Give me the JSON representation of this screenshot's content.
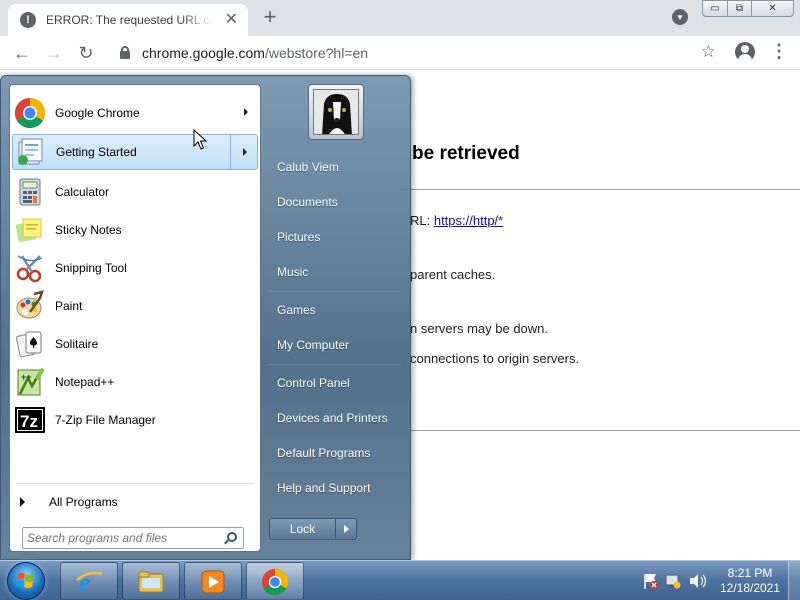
{
  "browser": {
    "tab_title": "ERROR: The requested URL could not be retrieved",
    "tab_icon_glyph": "!",
    "new_tab_glyph": "+",
    "close_glyph": "✕",
    "url_host": "chrome.google.com",
    "url_path": "/webstore?hl=en",
    "back_glyph": "←",
    "forward_glyph": "→",
    "reload_glyph": "↻",
    "star_glyph": "☆",
    "menu_glyph": "⋮",
    "min_glyph": "▭",
    "max_glyph": "⧉",
    "winclose_glyph": "✕"
  },
  "page": {
    "heading": "be retrieved",
    "line1_prefix": "RL: ",
    "line1_link": "https://http/*",
    "line2": "parent caches.",
    "line3": "n servers may be down.",
    "line4": "connections to origin servers."
  },
  "start_menu": {
    "programs": [
      {
        "label": "Google Chrome",
        "icon": "chrome-icon",
        "has_arrow": true
      },
      {
        "label": "Getting Started",
        "icon": "getting-started-icon",
        "has_arrow": true,
        "highlighted": true
      },
      {
        "label": "Calculator",
        "icon": "calculator-icon"
      },
      {
        "label": "Sticky Notes",
        "icon": "sticky-notes-icon"
      },
      {
        "label": "Snipping Tool",
        "icon": "scissors-icon"
      },
      {
        "label": "Paint",
        "icon": "palette-icon"
      },
      {
        "label": "Solitaire",
        "icon": "cards-icon"
      },
      {
        "label": "Notepad++",
        "icon": "notepad-plus-icon"
      },
      {
        "label": "7-Zip File Manager",
        "icon": "7zip-icon"
      }
    ],
    "all_programs": "All Programs",
    "search_placeholder": "Search programs and files",
    "right_links": [
      "Calub Viem",
      "Documents",
      "Pictures",
      "Music",
      "Games",
      "My Computer",
      "Control Panel",
      "Devices and Printers",
      "Default Programs",
      "Help and Support"
    ],
    "lock_label": "Lock"
  },
  "taskbar": {
    "time": "8:21 PM",
    "date": "12/18/2021",
    "buttons": [
      "internet-explorer-icon",
      "folder-icon",
      "media-player-icon",
      "chrome-icon"
    ]
  },
  "colors": {
    "link": "#1a0dab",
    "taskbar": "#4e73a0",
    "highlight": "#c3e0f8"
  }
}
